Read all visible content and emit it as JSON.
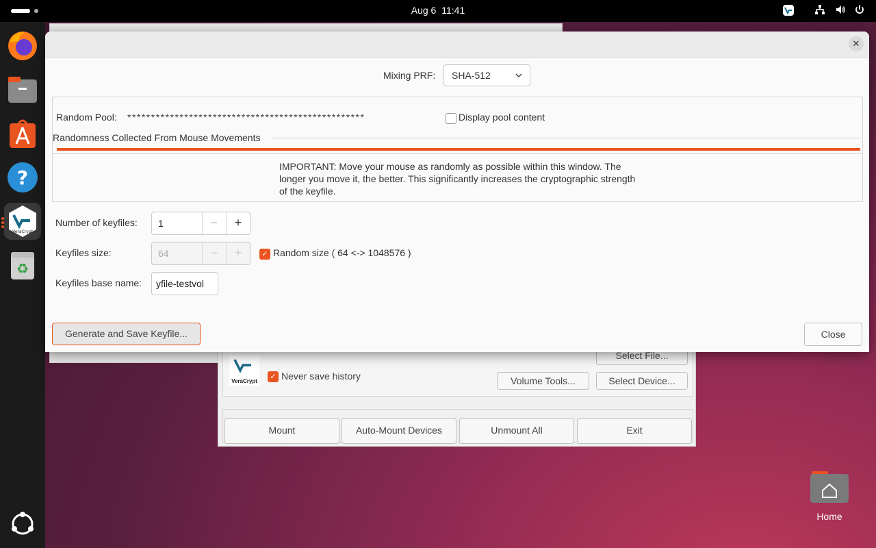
{
  "topbar": {
    "date": "Aug 6",
    "time": "11:41"
  },
  "dock": {
    "items": [
      {
        "name": "firefox-icon"
      },
      {
        "name": "files-icon"
      },
      {
        "name": "app-center-icon"
      },
      {
        "name": "help-icon"
      },
      {
        "name": "veracrypt-icon",
        "label": "VeraCrypt"
      },
      {
        "name": "trash-icon"
      }
    ]
  },
  "desktop": {
    "home_label": "Home"
  },
  "main_window": {
    "history_label": "Never save history",
    "volume_tools": "Volume Tools...",
    "select_device": "Select Device...",
    "select_file": "Select File...",
    "logo_text": "VeraCrypt",
    "buttons": [
      "Mount",
      "Auto-Mount Devices",
      "Unmount All",
      "Exit"
    ]
  },
  "dialog": {
    "mixing_label": "Mixing PRF:",
    "mixing_value": "SHA-512",
    "random_pool_label": "Random Pool:",
    "random_pool_value": "**************************************************",
    "display_pool_label": "Display pool content",
    "randomness_label": "Randomness Collected From Mouse Movements",
    "randomness_progress": 1.0,
    "important_text": "IMPORTANT: Move your mouse as randomly as possible within this window. The longer you move it, the better. This significantly increases the cryptographic strength of the keyfile.",
    "num_keyfiles_label": "Number of keyfiles:",
    "num_keyfiles_value": "1",
    "keyfiles_size_label": "Keyfiles size:",
    "keyfiles_size_value": "64",
    "random_size_label": "Random size ( 64 <-> 1048576 )",
    "base_name_label": "Keyfiles base name:",
    "base_name_value": "yfile-testvol",
    "generate_button": "Generate and Save Keyfile...",
    "close_button": "Close",
    "minus": "−",
    "plus": "+"
  },
  "colors": {
    "accent": "#e95420",
    "dock_bg": "#1b1b1b"
  }
}
